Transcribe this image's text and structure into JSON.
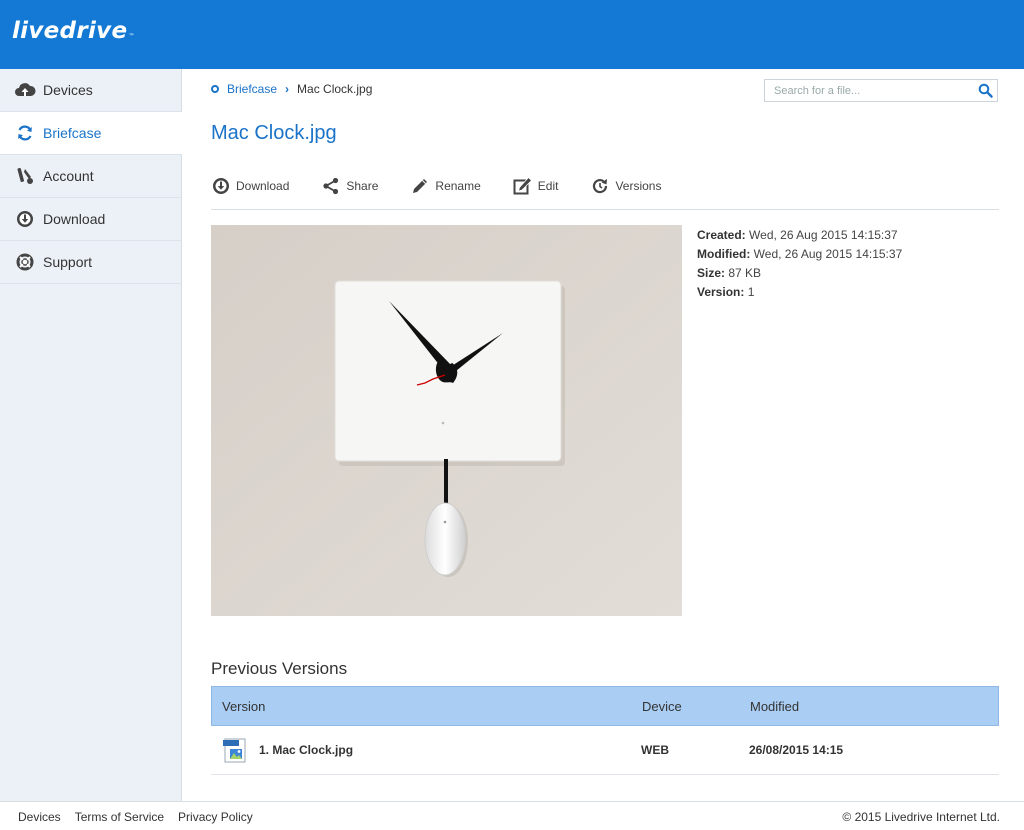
{
  "brand": {
    "name": "livedrive",
    "tm": "™",
    "color": "#1479d4"
  },
  "sidebar": {
    "items": [
      {
        "label": "Devices",
        "icon": "cloud-upload-icon"
      },
      {
        "label": "Briefcase",
        "icon": "sync-icon",
        "active": true
      },
      {
        "label": "Account",
        "icon": "tools-icon"
      },
      {
        "label": "Download",
        "icon": "download-circle-icon"
      },
      {
        "label": "Support",
        "icon": "lifebuoy-icon"
      }
    ]
  },
  "breadcrumb": {
    "root": "Briefcase",
    "current": "Mac Clock.jpg"
  },
  "search": {
    "placeholder": "Search for a file..."
  },
  "file": {
    "title": "Mac Clock.jpg"
  },
  "toolbar": {
    "download": "Download",
    "share": "Share",
    "rename": "Rename",
    "edit": "Edit",
    "versions": "Versions"
  },
  "meta": {
    "created_label": "Created:",
    "created_value": "Wed, 26 Aug 2015 14:15:37",
    "modified_label": "Modified:",
    "modified_value": "Wed, 26 Aug 2015 14:15:37",
    "size_label": "Size:",
    "size_value": "87 KB",
    "version_label": "Version:",
    "version_value": "1"
  },
  "previous_versions": {
    "title": "Previous Versions",
    "columns": [
      "Version",
      "Device",
      "Modified"
    ],
    "rows": [
      {
        "version": "1. Mac Clock.jpg",
        "device": "WEB",
        "modified": "26/08/2015 14:15"
      }
    ]
  },
  "footer": {
    "links": [
      "Devices",
      "Terms of Service",
      "Privacy Policy"
    ],
    "copyright": "© 2015 Livedrive Internet Ltd."
  }
}
